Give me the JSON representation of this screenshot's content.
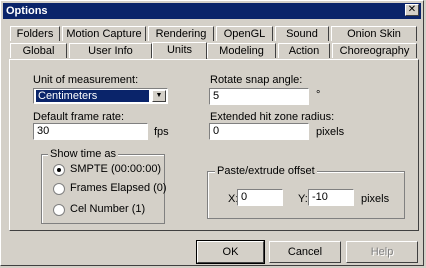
{
  "window": {
    "title": "Options",
    "close_glyph": "✕"
  },
  "tabs_row1": [
    "Folders",
    "Motion Capture",
    "Rendering",
    "OpenGL",
    "Sound",
    "Onion Skin"
  ],
  "tabs_row2": [
    "Global",
    "User Info",
    "Units",
    "Modeling",
    "Action",
    "Choreography"
  ],
  "active_tab": "Units",
  "units": {
    "unit_label": "Unit of measurement:",
    "unit_value": "Centimeters",
    "frame_rate_label": "Default frame rate:",
    "frame_rate_value": "30",
    "frame_rate_suffix": "fps",
    "show_time_label": "Show time as",
    "radio_options": [
      "SMPTE (00:00:00)",
      "Frames Elapsed (0)",
      "Cel Number (1)"
    ],
    "radio_selected": 0,
    "rotate_label": "Rotate snap angle:",
    "rotate_value": "5",
    "rotate_suffix": "°",
    "hit_zone_label": "Extended hit zone radius:",
    "hit_zone_value": "0",
    "hit_zone_suffix": "pixels",
    "paste_label": "Paste/extrude offset",
    "x_label": "X:",
    "x_value": "0",
    "y_label": "Y:",
    "y_value": "-10",
    "offset_suffix": "pixels"
  },
  "buttons": {
    "ok": "OK",
    "cancel": "Cancel",
    "help": "Help"
  }
}
